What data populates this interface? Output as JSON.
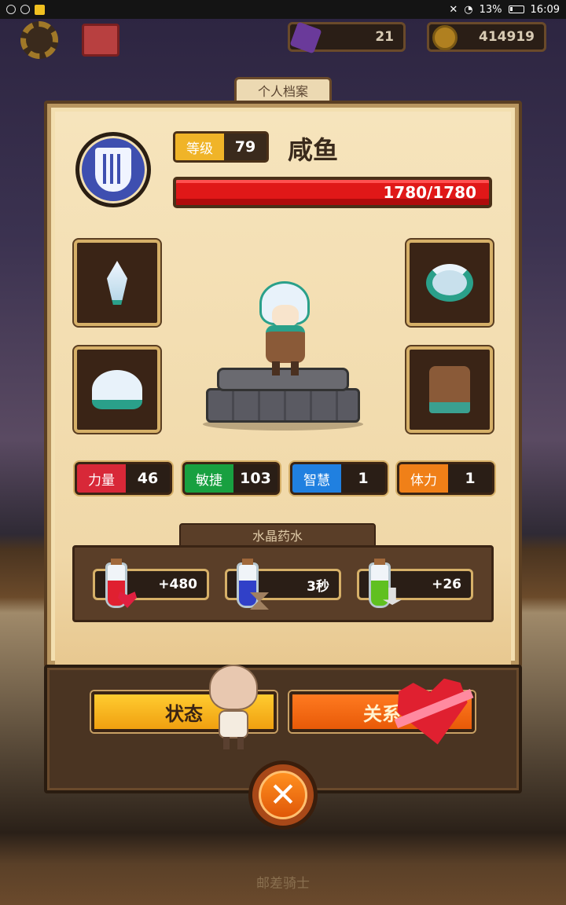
{
  "status_bar": {
    "battery": "13%",
    "time": "16:09"
  },
  "resources": {
    "gems": "21",
    "coins": "414919"
  },
  "profile_tab": "个人档案",
  "player": {
    "level_label": "等级",
    "level": "79",
    "name": "咸鱼",
    "hp": "1780/1780"
  },
  "stats": [
    {
      "label": "力量",
      "value": "46",
      "color": "#d82838"
    },
    {
      "label": "敏捷",
      "value": "103",
      "color": "#18a040"
    },
    {
      "label": "智慧",
      "value": "1",
      "color": "#2080e0"
    },
    {
      "label": "体力",
      "value": "1",
      "color": "#f08018"
    }
  ],
  "potions": {
    "title": "水晶药水",
    "items": [
      {
        "value": "+480",
        "liquid": "#e02030",
        "icon": "heart-icon"
      },
      {
        "value": "3秒",
        "liquid": "#3040c8",
        "icon": "hourglass-icon"
      },
      {
        "value": "+26",
        "liquid": "#60c020",
        "icon": "attack-up-icon"
      }
    ]
  },
  "buttons": {
    "status": "状态",
    "relationship": "关系",
    "close": "✕"
  },
  "footer_text": "邮差骑士"
}
